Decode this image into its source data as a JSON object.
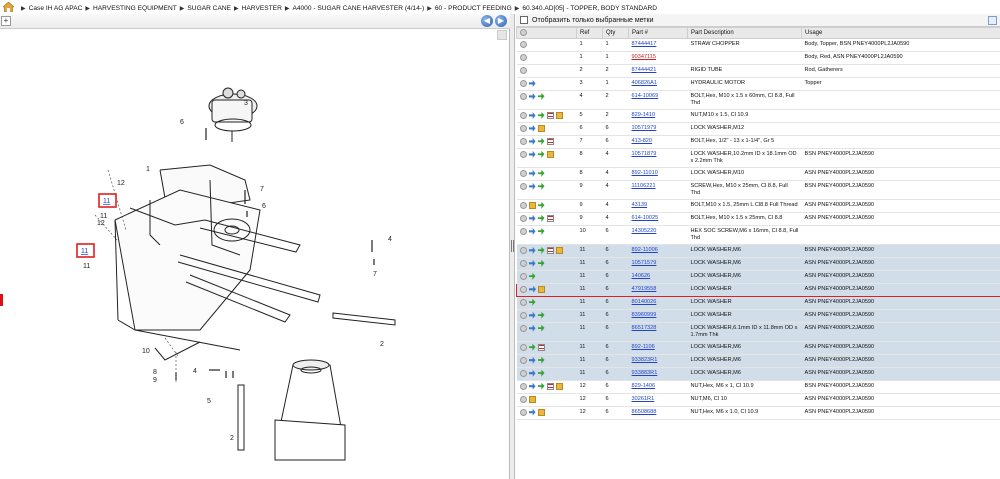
{
  "breadcrumb": [
    "Case IH AG APAC",
    "HARVESTING EQUIPMENT",
    "SUGAR CANE",
    "HARVESTER",
    "A4000 - SUGAR CANE HARVESTER (4/14-)",
    "60 - PRODUCT FEEDING",
    "60.340.AD[05] - TOPPER, BODY STANDARD"
  ],
  "separator": "▶",
  "left_toolbar": {
    "expand_label": "+",
    "prev_label": "◀",
    "next_label": "▶"
  },
  "diagram": {
    "callouts": [
      "1",
      "2",
      "2",
      "3",
      "4",
      "4",
      "5",
      "6",
      "6",
      "7",
      "7",
      "8",
      "9",
      "10",
      "11",
      "11",
      "12",
      "12"
    ],
    "highlight_tags": [
      "11",
      "11"
    ]
  },
  "right_toolbar": {
    "checkbox_label": "Отобразить только выбранные метки"
  },
  "table": {
    "columns": [
      "",
      "Ref",
      "Qty",
      "Part #",
      "Part Description",
      "Usage"
    ],
    "rows": [
      {
        "icons": [
          "info"
        ],
        "ref": "1",
        "qty": "1",
        "part": "87444417",
        "desc": "STRAW CHOPPER",
        "usage": "Body, Topper, BSN PNEY4000PL2JA0590"
      },
      {
        "icons": [
          "info"
        ],
        "ref": "1",
        "qty": "1",
        "part": "90347115",
        "red": true,
        "desc": "",
        "usage": "Body, Red, ASN PNEY4000PL2JA0590"
      },
      {
        "icons": [
          "info"
        ],
        "ref": "2",
        "qty": "2",
        "part": "87444421",
        "desc": "RIGID TUBE",
        "usage": "Rod, Gatherers"
      },
      {
        "icons": [
          "info",
          "blue"
        ],
        "ref": "3",
        "qty": "1",
        "part": "406826A1",
        "desc": "HYDRAULIC MOTOR",
        "usage": "Topper"
      },
      {
        "icons": [
          "info",
          "blue",
          "green"
        ],
        "ref": "4",
        "qty": "2",
        "part": "614-10069",
        "desc": "BOLT,Hex, M10 x 1.5 x 60mm, Cl 8.8, Full Thd",
        "usage": "",
        "tall": true
      },
      {
        "icons": [
          "info",
          "blue",
          "green",
          "list",
          "yellow"
        ],
        "ref": "5",
        "qty": "2",
        "part": "829-1410",
        "desc": "NUT,M10 x 1.5, Cl 10.9",
        "usage": ""
      },
      {
        "icons": [
          "info",
          "blue",
          "yellow"
        ],
        "ref": "6",
        "qty": "6",
        "part": "10571979",
        "desc": "LOCK WASHER,M12",
        "usage": ""
      },
      {
        "icons": [
          "info",
          "blue",
          "green",
          "list"
        ],
        "ref": "7",
        "qty": "6",
        "part": "413-820",
        "desc": "BOLT,Hex, 1/2\" - 13 x 1-1/4\", Gr 5",
        "usage": ""
      },
      {
        "icons": [
          "info",
          "blue",
          "green",
          "yellow"
        ],
        "ref": "8",
        "qty": "4",
        "part": "10571879",
        "desc": "LOCK WASHER,10.2mm ID x 18.1mm OD x 2.2mm Thk",
        "usage": "BSN PNEY4000PL2JA0590",
        "tall": true
      },
      {
        "icons": [
          "info",
          "blue",
          "green"
        ],
        "ref": "8",
        "qty": "4",
        "part": "892-11010",
        "desc": "LOCK WASHER,M10",
        "usage": "ASN PNEY4000PL2JA0590"
      },
      {
        "icons": [
          "info",
          "blue",
          "green"
        ],
        "ref": "9",
        "qty": "4",
        "part": "11106221",
        "desc": "SCREW,Hex, M10 x 25mm, Cl 8.8, Full Thd",
        "usage": "BSN PNEY4000PL2JA0590"
      },
      {
        "icons": [
          "info",
          "yellow",
          "green"
        ],
        "ref": "9",
        "qty": "4",
        "part": "43139",
        "desc": "BOLT,M10 x 1.5, 25mm L Cl8.8 Full Thread",
        "usage": "ASN PNEY4000PL2JA0590"
      },
      {
        "icons": [
          "info",
          "blue",
          "green",
          "list"
        ],
        "ref": "9",
        "qty": "4",
        "part": "614-10025",
        "desc": "BOLT,Hex, M10 x 1.5 x 25mm, Cl 8.8",
        "usage": "ASN PNEY4000PL2JA0590"
      },
      {
        "icons": [
          "info",
          "blue",
          "green"
        ],
        "ref": "10",
        "qty": "6",
        "part": "14305220",
        "desc": "HEX SOC SCREW,M6 x 16mm, Cl 8.8, Full Thd",
        "usage": "",
        "tall": true
      },
      {
        "icons": [
          "info",
          "blue",
          "green",
          "list",
          "yellow"
        ],
        "ref": "11",
        "qty": "6",
        "part": "892-11006",
        "desc": "LOCK WASHER,M6",
        "usage": "BSN PNEY4000PL2JA0590",
        "sel": true
      },
      {
        "icons": [
          "info",
          "blue",
          "green"
        ],
        "ref": "11",
        "qty": "6",
        "part": "10571579",
        "desc": "LOCK WASHER,M6",
        "usage": "ASN PNEY4000PL2JA0590",
        "sel": true
      },
      {
        "icons": [
          "info",
          "green"
        ],
        "ref": "11",
        "qty": "6",
        "part": "140626",
        "desc": "LOCK WASHER,M6",
        "usage": "ASN PNEY4000PL2JA0590",
        "sel": true
      },
      {
        "icons": [
          "info",
          "blue",
          "yellow"
        ],
        "ref": "11",
        "qty": "6",
        "part": "47919558",
        "desc": "LOCK WASHER",
        "usage": "ASN PNEY4000PL2JA0590",
        "sel": true,
        "hl": true
      },
      {
        "icons": [
          "info",
          "green"
        ],
        "ref": "11",
        "qty": "6",
        "part": "80140026",
        "desc": "LOCK WASHER",
        "usage": "ASN PNEY4000PL2JA0590",
        "sel": true
      },
      {
        "icons": [
          "info",
          "blue",
          "green"
        ],
        "ref": "11",
        "qty": "6",
        "part": "83960999",
        "desc": "LOCK WASHER",
        "usage": "ASN PNEY4000PL2JA0590",
        "sel": true
      },
      {
        "icons": [
          "info",
          "blue",
          "green"
        ],
        "ref": "11",
        "qty": "6",
        "part": "86517328",
        "desc": "LOCK WASHER,6.1mm ID x 11.8mm OD x 1.7mm Thk",
        "usage": "ASN PNEY4000PL2JA0590",
        "sel": true,
        "tall": true
      },
      {
        "icons": [
          "info",
          "green",
          "list"
        ],
        "ref": "11",
        "qty": "6",
        "part": "892-1106",
        "desc": "LOCK WASHER,M6",
        "usage": "ASN PNEY4000PL2JA0590",
        "sel": true
      },
      {
        "icons": [
          "info",
          "blue",
          "green"
        ],
        "ref": "11",
        "qty": "6",
        "part": "933823R1",
        "desc": "LOCK WASHER,M6",
        "usage": "ASN PNEY4000PL2JA0590",
        "sel": true
      },
      {
        "icons": [
          "info",
          "blue",
          "green"
        ],
        "ref": "11",
        "qty": "6",
        "part": "933883R1",
        "desc": "LOCK WASHER,M6",
        "usage": "ASN PNEY4000PL2JA0590",
        "sel": true
      },
      {
        "icons": [
          "info",
          "blue",
          "green",
          "list",
          "yellow"
        ],
        "ref": "12",
        "qty": "6",
        "part": "829-1406",
        "desc": "NUT,Hex, M6 x 1, Cl 10.9",
        "usage": "BSN PNEY4000PL2JA0590"
      },
      {
        "icons": [
          "info",
          "yellow"
        ],
        "ref": "12",
        "qty": "6",
        "part": "30261R1",
        "desc": "NUT,M6, Cl 10",
        "usage": "ASN PNEY4000PL2JA0590"
      },
      {
        "icons": [
          "info",
          "blue",
          "yellow"
        ],
        "ref": "12",
        "qty": "6",
        "part": "86508688",
        "desc": "NUT,Hex, M6 x 1.0, Cl 10.9",
        "usage": "ASN PNEY4000PL2JA0590"
      }
    ]
  }
}
